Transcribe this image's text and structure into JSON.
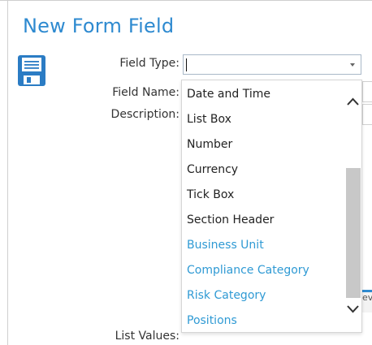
{
  "page": {
    "title": "New Form Field"
  },
  "form": {
    "field_type_label": "Field Type:",
    "field_type_value": "",
    "field_name_label": "Field Name:",
    "description_label": "Description:",
    "list_values_label": "List Values:"
  },
  "dropdown": {
    "options": [
      {
        "label": "Date and Time",
        "style": "normal"
      },
      {
        "label": "List Box",
        "style": "normal"
      },
      {
        "label": "Number",
        "style": "normal"
      },
      {
        "label": "Currency",
        "style": "normal"
      },
      {
        "label": "Tick Box",
        "style": "normal"
      },
      {
        "label": "Section Header",
        "style": "normal"
      },
      {
        "label": "Business Unit",
        "style": "linked"
      },
      {
        "label": "Compliance Category",
        "style": "linked"
      },
      {
        "label": "Risk Category",
        "style": "linked"
      },
      {
        "label": "Positions",
        "style": "linked"
      }
    ]
  },
  "partial_button": {
    "text": "ev"
  },
  "colors": {
    "accent": "#2e8ad0",
    "linked_option": "#2f9ad4",
    "icon": "#2b7cc4"
  },
  "icons": {
    "save": "save-icon",
    "dropdown": "chevron-down-icon"
  }
}
